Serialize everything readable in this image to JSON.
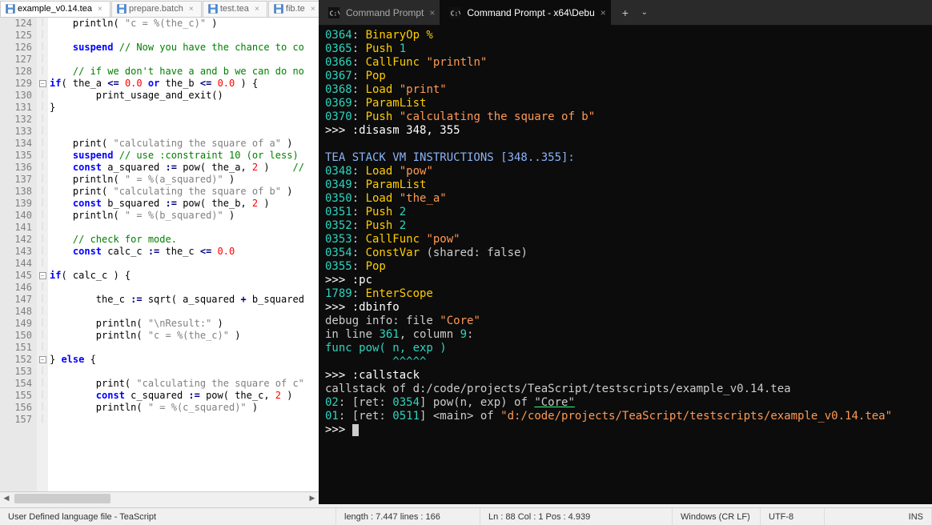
{
  "editor": {
    "tabs": [
      {
        "name": "example_v0.14.tea",
        "active": true
      },
      {
        "name": "prepare.batch",
        "active": false
      },
      {
        "name": "test.tea",
        "active": false
      },
      {
        "name": "fib.te",
        "active": false
      }
    ],
    "line_start": 124,
    "line_end": 157,
    "fold_lines": [
      129,
      145,
      152
    ],
    "code": [
      {
        "n": 124,
        "tokens": [
          [
            "fn",
            "    println( "
          ],
          [
            "str",
            "\"c = %(the_c)\""
          ],
          [
            "fn",
            " )"
          ]
        ]
      },
      {
        "n": 125,
        "tokens": []
      },
      {
        "n": 126,
        "tokens": [
          [
            "fn",
            "    "
          ],
          [
            "kw",
            "suspend"
          ],
          [
            "fn",
            " "
          ],
          [
            "cmt",
            "// Now you have the chance to co"
          ]
        ]
      },
      {
        "n": 127,
        "tokens": []
      },
      {
        "n": 128,
        "tokens": [
          [
            "fn",
            "    "
          ],
          [
            "cmt",
            "// if we don't have a and b we can do no"
          ]
        ]
      },
      {
        "n": 129,
        "tokens": [
          [
            "kw",
            "if"
          ],
          [
            "fn",
            "( the_a "
          ],
          [
            "op",
            "<="
          ],
          [
            "fn",
            " "
          ],
          [
            "num",
            "0.0"
          ],
          [
            "fn",
            " "
          ],
          [
            "kw",
            "or"
          ],
          [
            "fn",
            " the_b "
          ],
          [
            "op",
            "<="
          ],
          [
            "fn",
            " "
          ],
          [
            "num",
            "0.0"
          ],
          [
            "fn",
            " ) {"
          ]
        ]
      },
      {
        "n": 130,
        "tokens": [
          [
            "fn",
            "        print_usage_and_exit()"
          ]
        ]
      },
      {
        "n": 131,
        "tokens": [
          [
            "fn",
            "}"
          ]
        ]
      },
      {
        "n": 132,
        "tokens": []
      },
      {
        "n": 133,
        "tokens": []
      },
      {
        "n": 134,
        "tokens": [
          [
            "fn",
            "    print( "
          ],
          [
            "str",
            "\"calculating the square of a\""
          ],
          [
            "fn",
            " )"
          ]
        ]
      },
      {
        "n": 135,
        "tokens": [
          [
            "fn",
            "    "
          ],
          [
            "kw",
            "suspend"
          ],
          [
            "fn",
            " "
          ],
          [
            "cmt",
            "// use :constraint 10 (or less)"
          ]
        ]
      },
      {
        "n": 136,
        "tokens": [
          [
            "fn",
            "    "
          ],
          [
            "kw",
            "const"
          ],
          [
            "fn",
            " a_squared "
          ],
          [
            "op",
            ":="
          ],
          [
            "fn",
            " pow( the_a, "
          ],
          [
            "num",
            "2"
          ],
          [
            "fn",
            " )    "
          ],
          [
            "cmt",
            "//"
          ]
        ]
      },
      {
        "n": 137,
        "tokens": [
          [
            "fn",
            "    println( "
          ],
          [
            "str",
            "\" = %(a_squared)\""
          ],
          [
            "fn",
            " )"
          ]
        ]
      },
      {
        "n": 138,
        "tokens": [
          [
            "fn",
            "    print( "
          ],
          [
            "str",
            "\"calculating the square of b\""
          ],
          [
            "fn",
            " )"
          ]
        ]
      },
      {
        "n": 139,
        "tokens": [
          [
            "fn",
            "    "
          ],
          [
            "kw",
            "const"
          ],
          [
            "fn",
            " b_squared "
          ],
          [
            "op",
            ":="
          ],
          [
            "fn",
            " pow( the_b, "
          ],
          [
            "num",
            "2"
          ],
          [
            "fn",
            " )"
          ]
        ]
      },
      {
        "n": 140,
        "tokens": [
          [
            "fn",
            "    println( "
          ],
          [
            "str",
            "\" = %(b_squared)\""
          ],
          [
            "fn",
            " )"
          ]
        ]
      },
      {
        "n": 141,
        "tokens": []
      },
      {
        "n": 142,
        "tokens": [
          [
            "fn",
            "    "
          ],
          [
            "cmt",
            "// check for mode."
          ]
        ]
      },
      {
        "n": 143,
        "tokens": [
          [
            "fn",
            "    "
          ],
          [
            "kw",
            "const"
          ],
          [
            "fn",
            " calc_c "
          ],
          [
            "op",
            ":="
          ],
          [
            "fn",
            " the_c "
          ],
          [
            "op",
            "<="
          ],
          [
            "fn",
            " "
          ],
          [
            "num",
            "0.0"
          ]
        ]
      },
      {
        "n": 144,
        "tokens": []
      },
      {
        "n": 145,
        "tokens": [
          [
            "kw",
            "if"
          ],
          [
            "fn",
            "( calc_c ) {"
          ]
        ]
      },
      {
        "n": 146,
        "tokens": []
      },
      {
        "n": 147,
        "tokens": [
          [
            "fn",
            "        the_c "
          ],
          [
            "op",
            ":="
          ],
          [
            "fn",
            " sqrt( a_squared "
          ],
          [
            "op",
            "+"
          ],
          [
            "fn",
            " b_squared"
          ]
        ]
      },
      {
        "n": 148,
        "tokens": []
      },
      {
        "n": 149,
        "tokens": [
          [
            "fn",
            "        println( "
          ],
          [
            "str",
            "\"\\nResult:\""
          ],
          [
            "fn",
            " )"
          ]
        ]
      },
      {
        "n": 150,
        "tokens": [
          [
            "fn",
            "        println( "
          ],
          [
            "str",
            "\"c = %(the_c)\""
          ],
          [
            "fn",
            " )"
          ]
        ]
      },
      {
        "n": 151,
        "tokens": []
      },
      {
        "n": 152,
        "tokens": [
          [
            "fn",
            "} "
          ],
          [
            "kw",
            "else"
          ],
          [
            "fn",
            " {"
          ]
        ]
      },
      {
        "n": 153,
        "tokens": []
      },
      {
        "n": 154,
        "tokens": [
          [
            "fn",
            "        print( "
          ],
          [
            "str",
            "\"calculating the square of c\""
          ]
        ]
      },
      {
        "n": 155,
        "tokens": [
          [
            "fn",
            "        "
          ],
          [
            "kw",
            "const"
          ],
          [
            "fn",
            " c_squared "
          ],
          [
            "op",
            ":="
          ],
          [
            "fn",
            " pow( the_c, "
          ],
          [
            "num",
            "2"
          ],
          [
            "fn",
            " )"
          ]
        ]
      },
      {
        "n": 156,
        "tokens": [
          [
            "fn",
            "        println( "
          ],
          [
            "str",
            "\" = %(c_squared)\""
          ],
          [
            "fn",
            " )"
          ]
        ]
      },
      {
        "n": 157,
        "tokens": []
      }
    ]
  },
  "terminal": {
    "tabs": [
      {
        "label": "Command Prompt",
        "active": false
      },
      {
        "label": "Command Prompt - x64\\Debu",
        "active": true
      }
    ],
    "lines": [
      [
        [
          "t-num",
          "0364"
        ],
        [
          "",
          ": "
        ],
        [
          "t-op",
          "BinaryOp %"
        ]
      ],
      [
        [
          "t-num",
          "0365"
        ],
        [
          "",
          ": "
        ],
        [
          "t-op",
          "Push"
        ],
        [
          "",
          " "
        ],
        [
          "t-num",
          "1"
        ]
      ],
      [
        [
          "t-num",
          "0366"
        ],
        [
          "",
          ": "
        ],
        [
          "t-op",
          "CallFunc"
        ],
        [
          "",
          " "
        ],
        [
          "t-str",
          "\"println\""
        ]
      ],
      [
        [
          "t-num",
          "0367"
        ],
        [
          "",
          ": "
        ],
        [
          "t-op",
          "Pop"
        ]
      ],
      [
        [
          "t-num",
          "0368"
        ],
        [
          "",
          ": "
        ],
        [
          "t-op",
          "Load"
        ],
        [
          "",
          " "
        ],
        [
          "t-str",
          "\"print\""
        ]
      ],
      [
        [
          "t-num",
          "0369"
        ],
        [
          "",
          ": "
        ],
        [
          "t-op",
          "ParamList"
        ]
      ],
      [
        [
          "t-num",
          "0370"
        ],
        [
          "",
          ": "
        ],
        [
          "t-op",
          "Push"
        ],
        [
          "",
          " "
        ],
        [
          "t-str",
          "\"calculating the square of b\""
        ]
      ],
      [
        [
          "t-prompt",
          ">>> "
        ],
        [
          "t-cmd",
          ":disasm 348, 355"
        ]
      ],
      [
        [
          "",
          ""
        ]
      ],
      [
        [
          "t-hdr",
          "TEA STACK VM INSTRUCTIONS [348..355]:"
        ]
      ],
      [
        [
          "t-num",
          "0348"
        ],
        [
          "",
          ": "
        ],
        [
          "t-op",
          "Load"
        ],
        [
          "",
          " "
        ],
        [
          "t-str",
          "\"pow\""
        ]
      ],
      [
        [
          "t-num",
          "0349"
        ],
        [
          "",
          ": "
        ],
        [
          "t-op",
          "ParamList"
        ]
      ],
      [
        [
          "t-num",
          "0350"
        ],
        [
          "",
          ": "
        ],
        [
          "t-op",
          "Load"
        ],
        [
          "",
          " "
        ],
        [
          "t-str",
          "\"the_a\""
        ]
      ],
      [
        [
          "t-num",
          "0351"
        ],
        [
          "",
          ": "
        ],
        [
          "t-op",
          "Push"
        ],
        [
          "",
          " "
        ],
        [
          "t-num",
          "2"
        ]
      ],
      [
        [
          "t-num",
          "0352"
        ],
        [
          "",
          ": "
        ],
        [
          "t-op",
          "Push"
        ],
        [
          "",
          " "
        ],
        [
          "t-num",
          "2"
        ]
      ],
      [
        [
          "t-num",
          "0353"
        ],
        [
          "",
          ": "
        ],
        [
          "t-op",
          "CallFunc"
        ],
        [
          "",
          " "
        ],
        [
          "t-str",
          "\"pow\""
        ]
      ],
      [
        [
          "t-num",
          "0354"
        ],
        [
          "",
          ": "
        ],
        [
          "t-op",
          "ConstVar"
        ],
        [
          "",
          " (shared: false)"
        ]
      ],
      [
        [
          "t-num",
          "0355"
        ],
        [
          "",
          ": "
        ],
        [
          "t-op",
          "Pop"
        ]
      ],
      [
        [
          "t-prompt",
          ">>> "
        ],
        [
          "t-cmd",
          ":pc"
        ]
      ],
      [
        [
          "t-num",
          "1789"
        ],
        [
          "",
          ": "
        ],
        [
          "t-op",
          "EnterScope"
        ]
      ],
      [
        [
          "t-prompt",
          ">>> "
        ],
        [
          "t-cmd",
          ":dbinfo"
        ]
      ],
      [
        [
          "",
          "debug info: file "
        ],
        [
          "t-str",
          "\"Core\""
        ]
      ],
      [
        [
          "",
          "in line "
        ],
        [
          "t-num",
          "361"
        ],
        [
          "",
          ", column "
        ],
        [
          "t-num",
          "9"
        ],
        [
          "",
          ":"
        ]
      ],
      [
        [
          "t-cyan",
          "func pow( n, exp )"
        ]
      ],
      [
        [
          "t-cyan",
          "          ^^^^^"
        ]
      ],
      [
        [
          "t-prompt",
          ">>> "
        ],
        [
          "t-cmd",
          ":callstack"
        ]
      ],
      [
        [
          "",
          "callstack of d:/code/projects/TeaScript/testscripts/example_v0.14.tea"
        ]
      ],
      [
        [
          "t-num",
          "02"
        ],
        [
          "",
          ": [ret: "
        ],
        [
          "t-num",
          "0354"
        ],
        [
          "",
          "] pow(n, exp) of "
        ],
        [
          "t-ul",
          "\"Core\""
        ]
      ],
      [
        [
          "t-num",
          "01"
        ],
        [
          "",
          ": [ret: "
        ],
        [
          "t-num",
          "0511"
        ],
        [
          "",
          "] <main> of "
        ],
        [
          "t-str",
          "\"d:/code/projects/TeaScript/testscripts/example_v0.14.tea\""
        ]
      ],
      [
        [
          "t-prompt",
          ">>> "
        ],
        [
          "cursor",
          ""
        ]
      ]
    ]
  },
  "status": {
    "lang": "User Defined language file - TeaScript",
    "length": "length : 7.447    lines : 166",
    "pos": "Ln : 88    Col : 1    Pos : 4.939",
    "eol": "Windows (CR LF)",
    "enc": "UTF-8",
    "mode": "INS"
  }
}
